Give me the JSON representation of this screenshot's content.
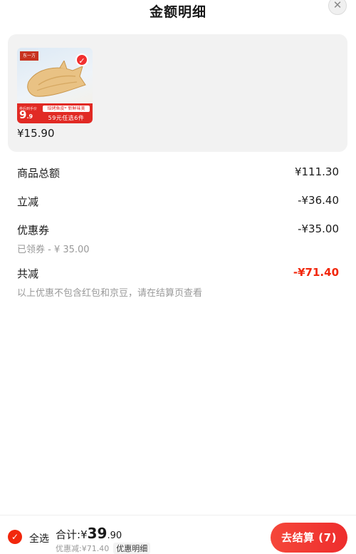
{
  "header": {
    "title": "金额明细",
    "close_icon": "close-icon"
  },
  "product": {
    "price": "¥15.90",
    "thumbnail": {
      "brand": "东一方",
      "promo_label": "券后到手价",
      "promo_price_int": "9",
      "promo_price_dec": ".9",
      "promo_tag": "焙烤鱼皮* 新鲜味美",
      "promo_text": "59元任选6件"
    },
    "selected": true
  },
  "summary": {
    "total_label": "商品总额",
    "total_value": "¥111.30",
    "instant_label": "立减",
    "instant_value": "-¥36.40",
    "coupon_label": "优惠券",
    "coupon_value": "-¥35.00",
    "coupon_sub": "已领券 - ¥ 35.00",
    "combined_label": "共减",
    "combined_value": "-¥71.40",
    "note": "以上优惠不包含红包和京豆，请在结算页查看"
  },
  "footer": {
    "select_all_label": "全选",
    "total_label": "合计:",
    "currency": "¥",
    "total_int": "39",
    "total_dec": ".90",
    "discount_text": "优惠减:¥71.40",
    "detail_label": "优惠明细",
    "checkout_label": "去结算 (7)"
  },
  "colors": {
    "accent": "#f2270c",
    "card_bg": "#f2f2f2"
  }
}
